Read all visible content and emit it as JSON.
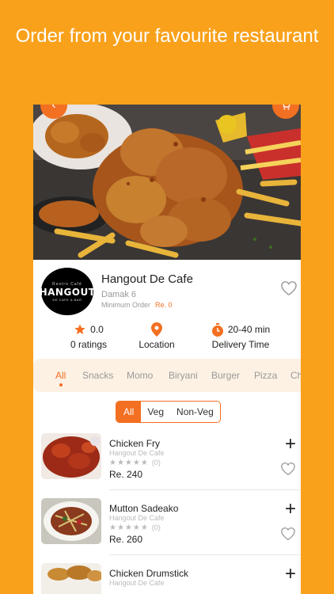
{
  "headline": "Order from your favourite restaurant",
  "colors": {
    "background": "#F9A11B",
    "accent": "#F36F21"
  },
  "header_icons": {
    "back": "chevron-left-icon",
    "cart": "cart-icon"
  },
  "restaurant": {
    "name": "Hangout De Cafe",
    "address": "Damak 6",
    "min_order_label": "Minimum Order",
    "min_order_value": "Re. 0",
    "logo_text": {
      "line1": "Restro Café",
      "line2": "HANGOUT",
      "line3": "DE CAFE & BAR"
    }
  },
  "stats": {
    "rating_value": "0.0",
    "rating_label": "0 ratings",
    "location_label": "Location",
    "delivery_time": "20-40 min",
    "delivery_label": "Delivery Time"
  },
  "categories": [
    "All",
    "Snacks",
    "Momo",
    "Biryani",
    "Burger",
    "Pizza",
    "Ch"
  ],
  "filter": {
    "options": [
      "All",
      "Veg",
      "Non-Veg"
    ],
    "selected": "All"
  },
  "items": [
    {
      "name": "Chicken Fry",
      "restaurant": "Hangout De Cafe",
      "stars": "★★★★★",
      "rating_count": "(0)",
      "price": "Re. 240"
    },
    {
      "name": "Mutton Sadeako",
      "restaurant": "Hangout De Cafe",
      "stars": "★★★★★",
      "rating_count": "(0)",
      "price": "Re. 260"
    },
    {
      "name": "Chicken Drumstick",
      "restaurant": "Hangout De Cafe",
      "stars": "",
      "rating_count": "",
      "price": ""
    }
  ]
}
